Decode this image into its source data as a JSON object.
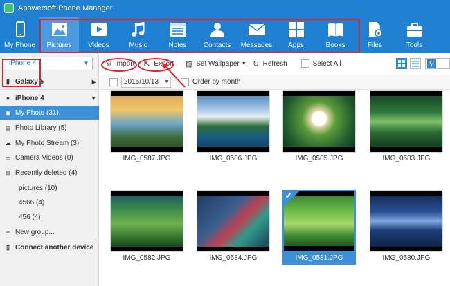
{
  "app": {
    "title": "Apowersoft Phone Manager"
  },
  "toolbar": {
    "items": [
      {
        "label": "My Phone",
        "icon": "phone-icon"
      },
      {
        "label": "Pictures",
        "icon": "picture-icon"
      },
      {
        "label": "Videos",
        "icon": "video-icon"
      },
      {
        "label": "Music",
        "icon": "music-icon"
      },
      {
        "label": "Notes",
        "icon": "notes-icon"
      },
      {
        "label": "Contacts",
        "icon": "contacts-icon"
      },
      {
        "label": "Messages",
        "icon": "messages-icon"
      },
      {
        "label": "Apps",
        "icon": "apps-icon"
      },
      {
        "label": "Books",
        "icon": "books-icon"
      },
      {
        "label": "Files",
        "icon": "files-icon"
      },
      {
        "label": "Tools",
        "icon": "tools-icon"
      }
    ],
    "active_index": 1
  },
  "sidebar": {
    "device_selected": "iPhone 4",
    "device_options": [
      "Galaxy 5",
      "iPhone 4"
    ],
    "items": [
      {
        "label": "My Photo (31)"
      },
      {
        "label": "Photo Library (5)"
      },
      {
        "label": "My Photo Stream (3)"
      },
      {
        "label": "Camera Videos (0)"
      },
      {
        "label": "Recently deleted (4)"
      },
      {
        "label": "pictures (10)"
      },
      {
        "label": "4566 (4)"
      },
      {
        "label": "456 (4)"
      },
      {
        "label": "New group..."
      }
    ],
    "connect_label": "Connect another device"
  },
  "actions": {
    "import": "Import",
    "export": "Export",
    "set_wallpaper": "Set Wallpaper",
    "refresh": "Refresh",
    "select_all": "Select All"
  },
  "filter": {
    "date": "2015/10/13",
    "order_label": "Order by month"
  },
  "photos": [
    {
      "name": "IMG_0587.JPG",
      "selected": false
    },
    {
      "name": "IMG_0586.JPG",
      "selected": false
    },
    {
      "name": "IMG_0585.JPG",
      "selected": false
    },
    {
      "name": "IMG_0583.JPG",
      "selected": false
    },
    {
      "name": "IMG_0582.JPG",
      "selected": false
    },
    {
      "name": "IMG_0584.JPG",
      "selected": false
    },
    {
      "name": "IMG_0581.JPG",
      "selected": true
    },
    {
      "name": "IMG_0580.JPG",
      "selected": false
    }
  ],
  "colors": {
    "brand_blue": "#1f7fd1",
    "selection_blue": "#3d8fd6",
    "annotation_red": "#e0242e"
  }
}
